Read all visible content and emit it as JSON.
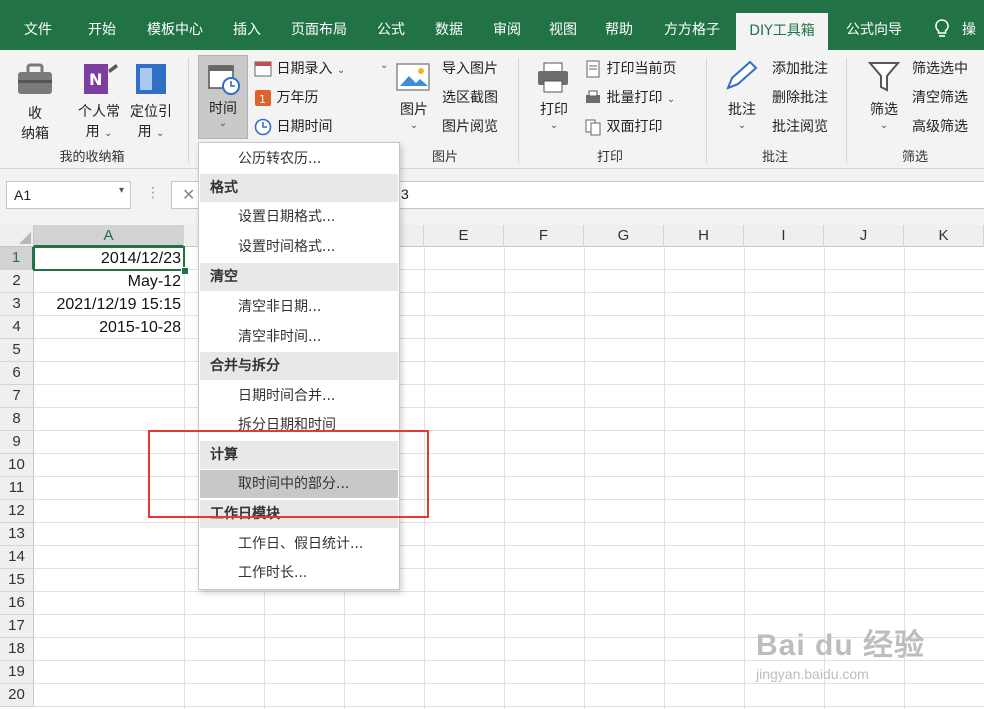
{
  "tabs": [
    "文件",
    "开始",
    "模板中心",
    "插入",
    "页面布局",
    "公式",
    "数据",
    "审阅",
    "视图",
    "帮助",
    "方方格子",
    "DIY工具箱",
    "公式向导",
    "操"
  ],
  "active_tab": "DIY工具箱",
  "ribbon": {
    "group_storage": {
      "label": "我的收纳箱",
      "btn1": "收\n纳箱",
      "btn1_a": "收",
      "btn1_b": "纳箱",
      "btn2_a": "个人常",
      "btn2_b": "用",
      "btn3_a": "定位引",
      "btn3_b": "用"
    },
    "group_time": {
      "time_btn": "时间",
      "date_entry": "日期录入",
      "calendar": "万年历",
      "date_time": "日期时间"
    },
    "group_picture": {
      "label": "图片",
      "picture_btn": "图片",
      "import_picture": "导入图片",
      "area_screenshot": "选区截图",
      "picture_browse": "图片阅览"
    },
    "group_print": {
      "label": "打印",
      "print_btn": "打印",
      "print_current": "打印当前页",
      "batch_print": "批量打印",
      "duplex_print": "双面打印"
    },
    "group_comment": {
      "label": "批注",
      "comment_btn": "批注",
      "add_comment": "添加批注",
      "delete_comment": "删除批注",
      "browse_comment": "批注阅览"
    },
    "group_filter": {
      "label": "筛选",
      "filter_btn": "筛选",
      "filter_selected": "筛选选中",
      "clear_filter": "清空筛选",
      "advanced_filter": "高级筛选"
    }
  },
  "namebox": "A1",
  "formula_tail": "3",
  "columns": [
    "A",
    "",
    "",
    "E",
    "F",
    "G",
    "H",
    "I",
    "J",
    "K"
  ],
  "rows": [
    "1",
    "2",
    "3",
    "4",
    "5",
    "6",
    "7",
    "8",
    "9",
    "10",
    "11",
    "12",
    "13",
    "14",
    "15",
    "16",
    "17",
    "18",
    "19",
    "20"
  ],
  "cells": {
    "A1": "2014/12/23",
    "A2": "May-12",
    "A3": "2021/12/19 15:15",
    "A4": "2015-10-28"
  },
  "menu": {
    "item_lunar": "公历转农历...",
    "sec_format": "格式",
    "item_set_date_fmt": "设置日期格式...",
    "item_set_time_fmt": "设置时间格式...",
    "sec_clear": "清空",
    "item_clear_nondate": "清空非日期...",
    "item_clear_nontime": "清空非时间...",
    "sec_merge_split": "合并与拆分",
    "item_merge_dt": "日期时间合并...",
    "item_split_dt": "拆分日期和时间",
    "sec_calc": "计算",
    "item_extract_part": "取时间中的部分...",
    "sec_workday": "工作日模块",
    "item_workday_stats": "工作日、假日统计...",
    "item_work_duration": "工作时长..."
  },
  "watermark": "Bai du 经验",
  "watermark_url": "jingyan.baidu.com",
  "colors": {
    "brand_green": "#217346",
    "highlight_box": "#e53935"
  }
}
